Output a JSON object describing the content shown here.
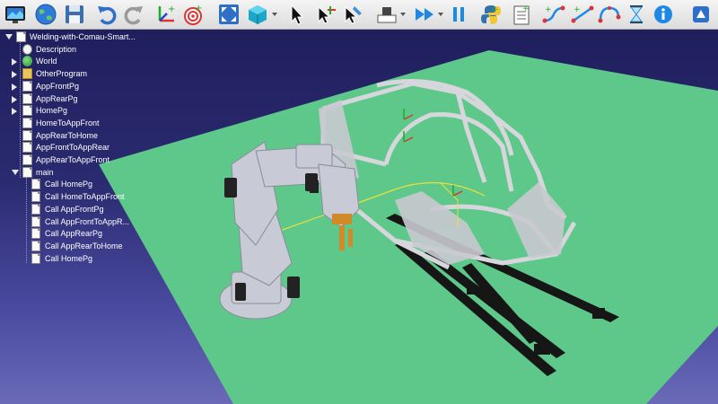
{
  "toolbar": {
    "buttons": [
      {
        "name": "open-station-button",
        "icon": "monitor-icon"
      },
      {
        "name": "open-online-library-button",
        "icon": "globe-icon"
      },
      {
        "name": "save-button",
        "icon": "floppy-disk-icon"
      },
      {
        "name": "undo-button",
        "icon": "undo-icon"
      },
      {
        "name": "redo-button",
        "icon": "redo-icon"
      },
      {
        "name": "add-reference-frame-button",
        "icon": "reference-frame-icon"
      },
      {
        "name": "add-target-button",
        "icon": "target-icon"
      },
      {
        "name": "fit-all-button",
        "icon": "fit-all-icon"
      },
      {
        "name": "view-3d-button",
        "icon": "cube-icon"
      },
      {
        "name": "select-button",
        "icon": "cursor-icon"
      },
      {
        "name": "move-reference-button",
        "icon": "cursor-move-icon"
      },
      {
        "name": "move-tool-button",
        "icon": "cursor-tool-icon"
      },
      {
        "name": "collision-map-button",
        "icon": "collision-icon"
      },
      {
        "name": "fast-simulation-button",
        "icon": "fast-forward-icon"
      },
      {
        "name": "pause-button",
        "icon": "pause-icon"
      },
      {
        "name": "add-python-program-button",
        "icon": "python-icon"
      },
      {
        "name": "add-program-button",
        "icon": "program-icon"
      },
      {
        "name": "add-joint-move-button",
        "icon": "joint-move-icon"
      },
      {
        "name": "add-linear-move-button",
        "icon": "linear-move-icon"
      },
      {
        "name": "add-circular-move-button",
        "icon": "circular-move-icon"
      },
      {
        "name": "add-pause-button",
        "icon": "hourglass-icon"
      },
      {
        "name": "info-button",
        "icon": "info-icon"
      }
    ]
  },
  "tree": {
    "root": "Welding-with-Comau-Smart...",
    "items": [
      {
        "label": "Description",
        "icon": "description-icon",
        "expander": "none"
      },
      {
        "label": "World",
        "icon": "world-icon",
        "expander": "collapsed"
      },
      {
        "label": "OtherProgram",
        "icon": "folder-icon",
        "expander": "collapsed"
      },
      {
        "label": "AppFrontPg",
        "icon": "program-icon",
        "expander": "collapsed"
      },
      {
        "label": "AppRearPg",
        "icon": "program-icon",
        "expander": "collapsed"
      },
      {
        "label": "HomePg",
        "icon": "program-icon",
        "expander": "collapsed"
      },
      {
        "label": "HomeToAppFront",
        "icon": "program-icon",
        "expander": "none"
      },
      {
        "label": "AppRearToHome",
        "icon": "program-icon",
        "expander": "none"
      },
      {
        "label": "AppFrontToAppRear",
        "icon": "program-icon",
        "expander": "none"
      },
      {
        "label": "AppRearToAppFront",
        "icon": "program-icon",
        "expander": "none"
      },
      {
        "label": "main",
        "icon": "program-icon",
        "expander": "expanded"
      }
    ],
    "main_children": [
      "Call HomePg",
      "Call HomeToAppFront",
      "Call AppFrontPg",
      "Call AppFrontToAppR...",
      "Call AppRearPg",
      "Call AppRearToHome",
      "Call HomePg"
    ]
  },
  "colors": {
    "floor": "#5ec88a",
    "background_top": "#1f1f5e",
    "background_bottom": "#6a6ab8",
    "robot": "#c8cad6",
    "rails": "#1a1a1a"
  }
}
